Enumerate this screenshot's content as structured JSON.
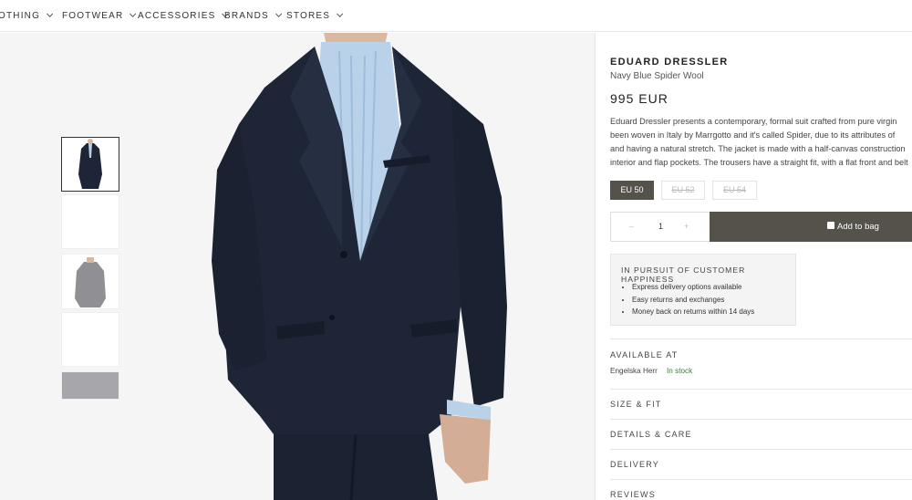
{
  "nav": {
    "items": [
      {
        "label": "OTHING"
      },
      {
        "label": "FOOTWEAR"
      },
      {
        "label": "ACCESSORIES"
      },
      {
        "label": "BRANDS"
      },
      {
        "label": "STORES"
      }
    ]
  },
  "product": {
    "brand": "EDUARD DRESSLER",
    "name": "Navy Blue Spider Wool",
    "price": "995 EUR",
    "description_lines": [
      "Eduard Dressler presents a contemporary, formal suit crafted from pure virgin",
      "been woven in Italy by Marrgotto and it's called Spider, due to its attributes of",
      "and having a natural stretch. The jacket is made with a half-canvas construction",
      "interior and flap pockets. The trousers have a straight fit, with a flat front and belt"
    ],
    "sizes": [
      {
        "label": "EU 50",
        "available": true,
        "selected": true
      },
      {
        "label": "EU 52",
        "available": false,
        "selected": false
      },
      {
        "label": "EU 54",
        "available": false,
        "selected": false
      }
    ],
    "quantity": {
      "minus": "–",
      "value": "1",
      "plus": "+"
    },
    "add_to_bag": "Add to bag"
  },
  "happiness": {
    "title": "IN PURSUIT OF CUSTOMER HAPPINESS",
    "items": [
      "Express delivery options available",
      "Easy returns and exchanges",
      "Money back on returns within 14 days"
    ]
  },
  "availability": {
    "title": "AVAILABLE AT",
    "store": "Engelska Herr",
    "status": "In stock"
  },
  "sections": {
    "size_fit": "SIZE & FIT",
    "details_care": "DETAILS & CARE",
    "delivery": "DELIVERY",
    "reviews": "REVIEWS"
  },
  "colors": {
    "accent": "#55524c",
    "in_stock": "#3a7d3a",
    "suit_navy": "#1e2536",
    "shirt_blue": "#b9d2ea"
  }
}
